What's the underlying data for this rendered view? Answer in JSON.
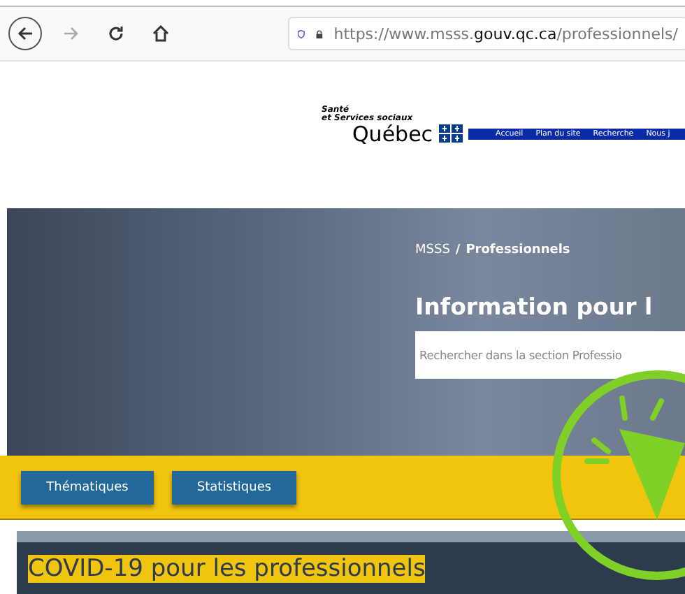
{
  "browser": {
    "url_host_prefix": "https://www.msss.",
    "url_domain": "gouv.qc.ca",
    "url_path": "/professionnels/"
  },
  "header": {
    "logo_line_1": "Santé",
    "logo_line_2": "et Services sociaux",
    "logo_name": "Québec",
    "nav": [
      "Accueil",
      "Plan du site",
      "Recherche",
      "Nous j"
    ]
  },
  "hero": {
    "breadcrumb_root": "MSSS",
    "breadcrumb_sep": "/",
    "breadcrumb_current": "Professionnels",
    "title": "Information pour l",
    "search": {
      "placeholder": "Rechercher dans la section Professio"
    }
  },
  "buttons": [
    "Thématiques",
    "Statistiques"
  ],
  "section": {
    "heading": "COVID-19 pour les professionnels"
  }
}
